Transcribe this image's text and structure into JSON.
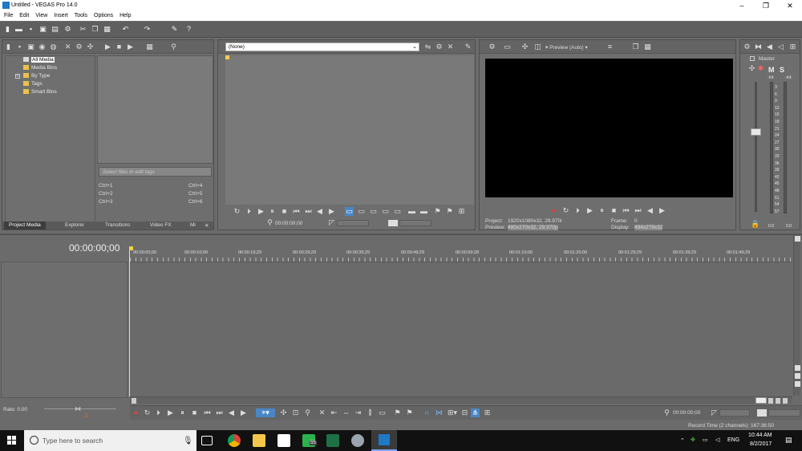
{
  "window": {
    "title": "Untitled - VEGAS Pro 14.0",
    "minimize": "–",
    "maximize": "❐",
    "close": "✕"
  },
  "menu": [
    "File",
    "Edit",
    "View",
    "Insert",
    "Tools",
    "Options",
    "Help"
  ],
  "project_media": {
    "tree": [
      "All Media",
      "Media Bins",
      "By Type",
      "Tags",
      "Smart Bins"
    ],
    "tag_placeholder": "Select files to edit tags",
    "shortcuts": [
      "Ctrl+1",
      "Ctrl+4",
      "Ctrl+2",
      "Ctrl+5",
      "Ctrl+3",
      "Ctrl+6"
    ],
    "tabs": [
      "Project Media",
      "Explorer",
      "Transitions",
      "Video FX",
      "Mi"
    ]
  },
  "trimmer": {
    "select_value": "(None)",
    "timecode": "00:00:00;00"
  },
  "preview": {
    "mode_label": "Preview (Auto)",
    "project_label": "Project:",
    "project_value": "1920x1080x32, 29.970i",
    "preview_label": "Preview:",
    "preview_value": "480x270x32, 29.970p",
    "frame_label": "Frame:",
    "frame_value": "0",
    "display_label": "Display:",
    "display_value": "494x278x32"
  },
  "mixer": {
    "master_label": "Master",
    "mute": "M",
    "solo": "S",
    "inf_left": "-Inf.",
    "inf_right": "-Inf.",
    "scale": [
      "3",
      "6",
      "9",
      "12",
      "15",
      "18",
      "21",
      "24",
      "27",
      "30",
      "33",
      "36",
      "39",
      "42",
      "45",
      "48",
      "51",
      "54",
      "57"
    ],
    "bottom_left": "0.0",
    "bottom_right": "0.0"
  },
  "timeline": {
    "timecode": "00:00:00;00",
    "ruler": [
      "00:00:00;00",
      "00:00:10;00",
      "00:00:19;29",
      "00:00:29;29",
      "00:00:39;29",
      "00:00:49;29",
      "00:00:59;28",
      "00:01:10;00",
      "00:01:20;00",
      "00:01:29;29",
      "00:01:39;29",
      "00:01:49;29"
    ],
    "rate_label": "Rate: 0.00",
    "bottom_timecode": "00:00:00;00",
    "record_time": "Record Time (2 channels): 167:36:50"
  },
  "taskbar": {
    "search_placeholder": "Type here to search",
    "badge": "55",
    "lang": "ENG",
    "time": "10:44 AM",
    "date": "8/2/2017"
  }
}
